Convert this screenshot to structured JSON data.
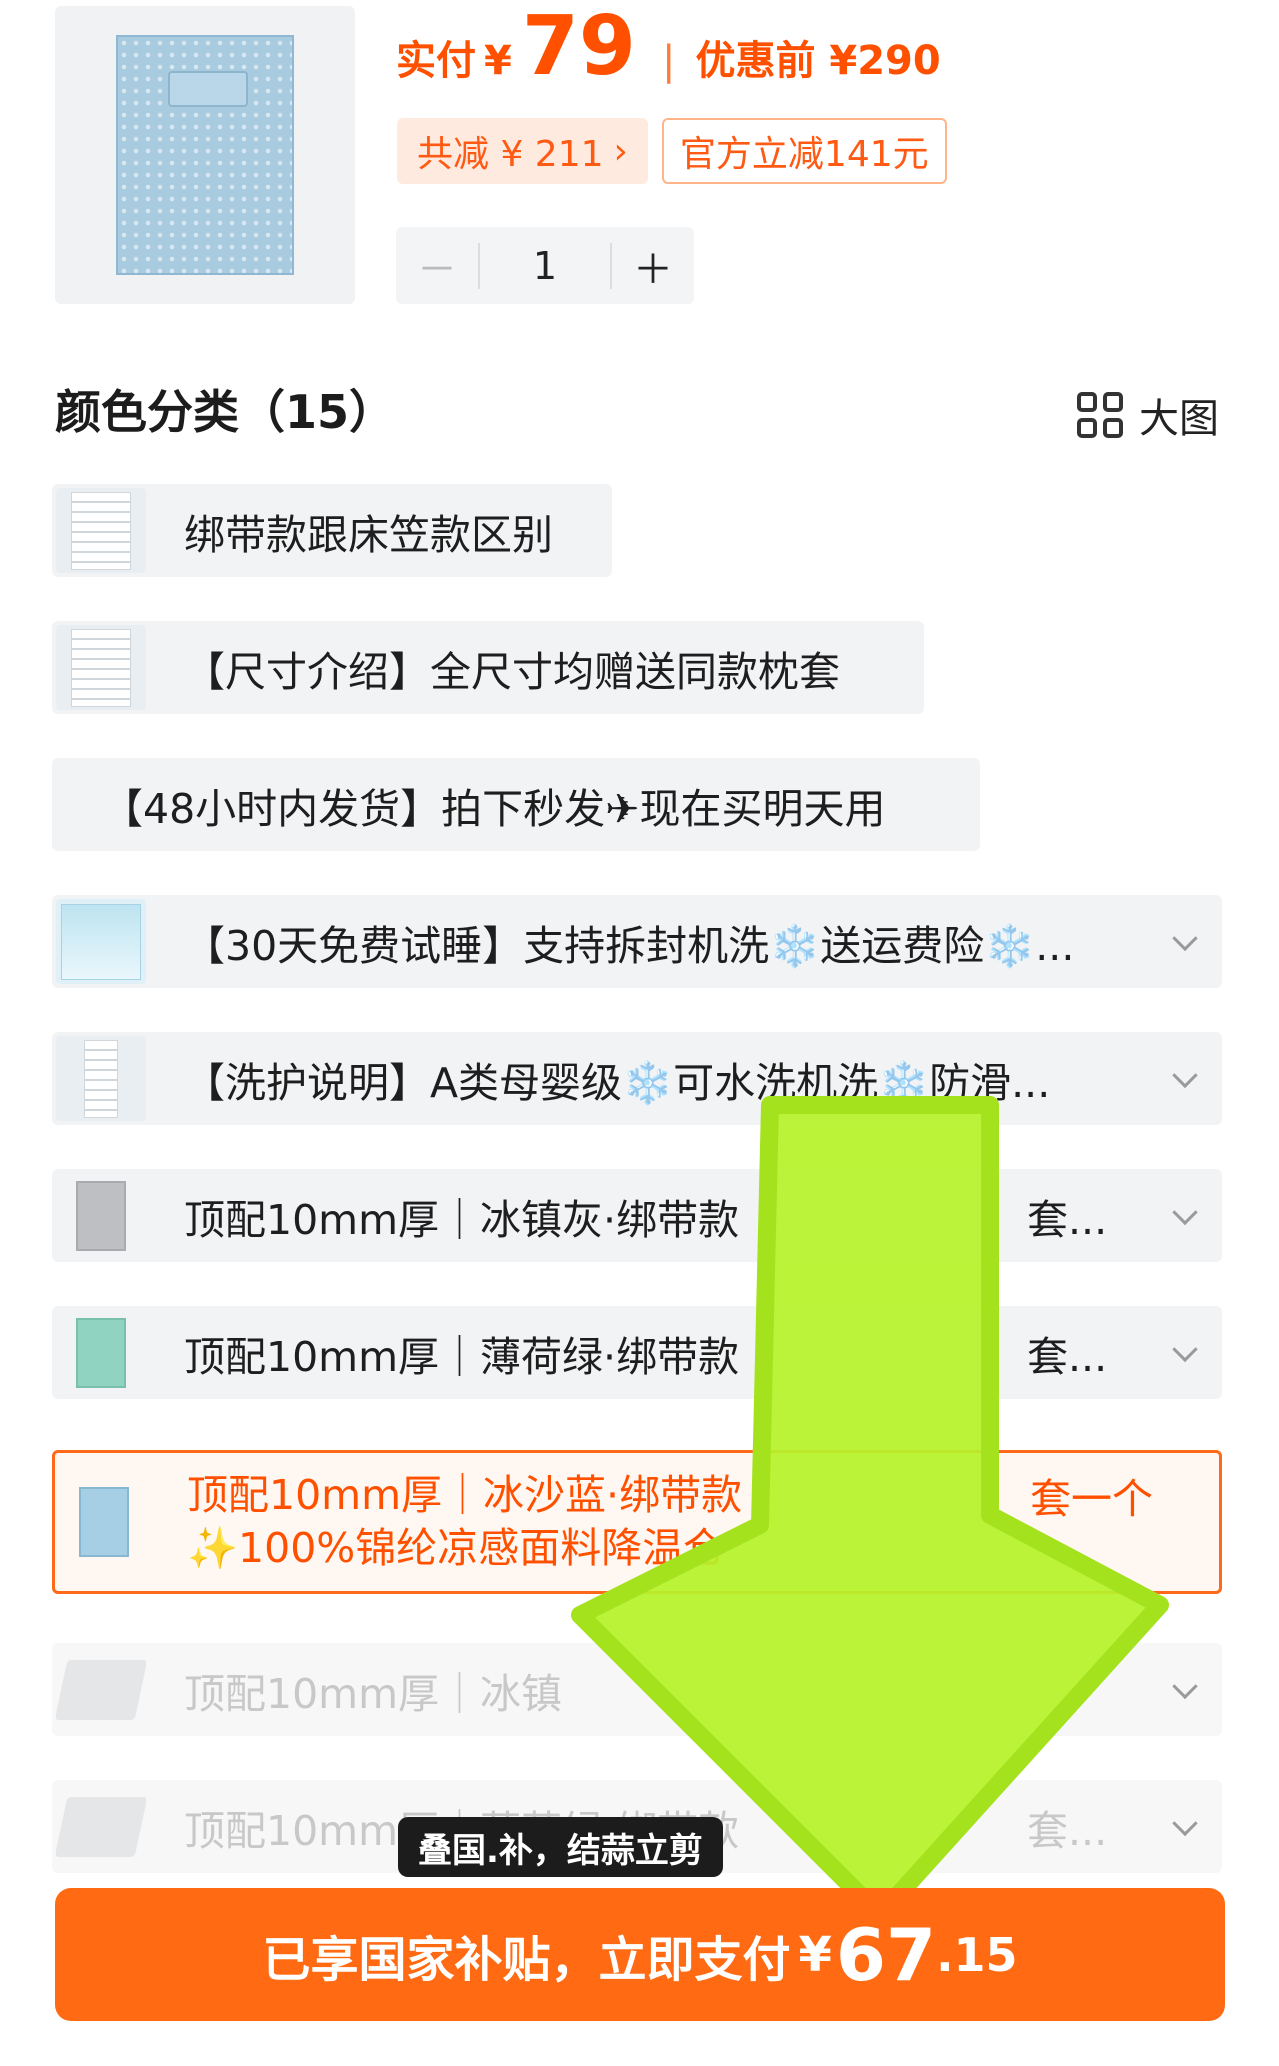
{
  "product": {
    "price_label": "实付",
    "price_currency": "¥",
    "price_value": "79",
    "price_separator": "|",
    "original_label": "优惠前 ¥290",
    "discount_badge": "共减 ¥ 211",
    "discount_chevron": "›",
    "official_badge": "官方立减141元",
    "quantity": "1",
    "minus": "－",
    "plus": "＋"
  },
  "section": {
    "title": "颜色分类（15）",
    "big_view_label": "大图",
    "grid_icon": "grid-icon"
  },
  "options": [
    {
      "label": "绑带款跟床笠款区别"
    },
    {
      "label": "【尺寸介绍】全尺寸均赠送同款枕套"
    },
    {
      "label": "【48小时内发货】拍下秒发✈现在买明天用"
    },
    {
      "label": "【30天免费试睡】支持拆封机洗❄️送运费险❄️..."
    },
    {
      "label": "【洗护说明】A类母婴级❄️可水洗机洗❄️防滑..."
    },
    {
      "label": "顶配10mm厚｜冰镇灰·绑带款",
      "label_tail": "套..."
    },
    {
      "label": "顶配10mm厚｜薄荷绿·绑带款",
      "label_tail": "套..."
    },
    {
      "label": "顶配10mm厚｜冰沙蓝·绑带款",
      "label_tail": "套一个",
      "label_line2": "✨100%锦纶凉感面料降温仓"
    },
    {
      "label": "顶配10mm厚｜冰镇"
    },
    {
      "label": "顶配10mm厚｜薄荷绿·绑带款",
      "label_tail": "套..."
    }
  ],
  "tooltip": "叠国.补，结蒜立剪",
  "pay": {
    "text": "已享国家补贴，立即支付",
    "currency": "¥",
    "integer": "67",
    "decimal": ".15"
  },
  "colors": {
    "accent": "#ff5000",
    "pay_button": "#ff6a12",
    "arrow": "#b6f22a"
  }
}
